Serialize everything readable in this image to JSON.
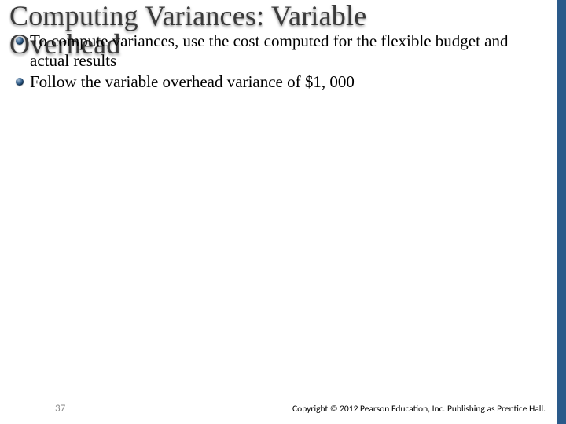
{
  "title": {
    "line1": "Computing Variances: Variable",
    "line2": "Overhead"
  },
  "bullets": [
    "To compute variances, use the cost computed for the flexible budget and actual results",
    "Follow the variable overhead variance of $1, 000"
  ],
  "footer": {
    "page": "37",
    "copyright": "Copyright © 2012 Pearson Education, Inc. Publishing as Prentice Hall."
  }
}
